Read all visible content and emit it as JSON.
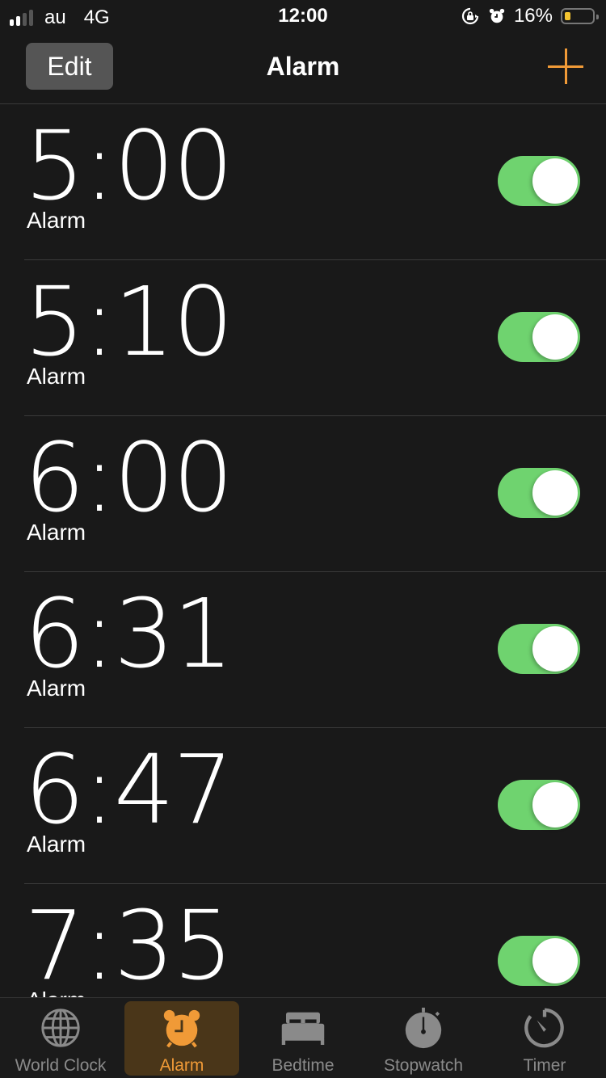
{
  "status_bar": {
    "carrier": "au",
    "network": "4G",
    "time": "12:00",
    "battery_percent_label": "16%",
    "battery_level": 0.16,
    "signal_bars_filled": 2,
    "signal_bars_total": 4,
    "icons": [
      "orientation-lock-icon",
      "alarm-clock-icon",
      "battery-icon"
    ]
  },
  "nav": {
    "edit_label": "Edit",
    "title": "Alarm",
    "add_icon": "plus-icon",
    "accent_color": "#f09a37"
  },
  "alarms": [
    {
      "time": "5:00",
      "label": "Alarm",
      "enabled": true
    },
    {
      "time": "5:10",
      "label": "Alarm",
      "enabled": true
    },
    {
      "time": "6:00",
      "label": "Alarm",
      "enabled": true
    },
    {
      "time": "6:31",
      "label": "Alarm",
      "enabled": true
    },
    {
      "time": "6:47",
      "label": "Alarm",
      "enabled": true
    },
    {
      "time": "7:35",
      "label": "Alarm",
      "enabled": true
    }
  ],
  "tabs": [
    {
      "label": "World Clock",
      "icon": "globe-icon",
      "active": false
    },
    {
      "label": "Alarm",
      "icon": "alarm-clock-icon",
      "active": true
    },
    {
      "label": "Bedtime",
      "icon": "bed-icon",
      "active": false
    },
    {
      "label": "Stopwatch",
      "icon": "stopwatch-icon",
      "active": false
    },
    {
      "label": "Timer",
      "icon": "timer-icon",
      "active": false
    }
  ],
  "colors": {
    "toggle_on": "#6fd36f",
    "active_tab": "#f09a37",
    "inactive_tab": "#8a8a8a"
  }
}
